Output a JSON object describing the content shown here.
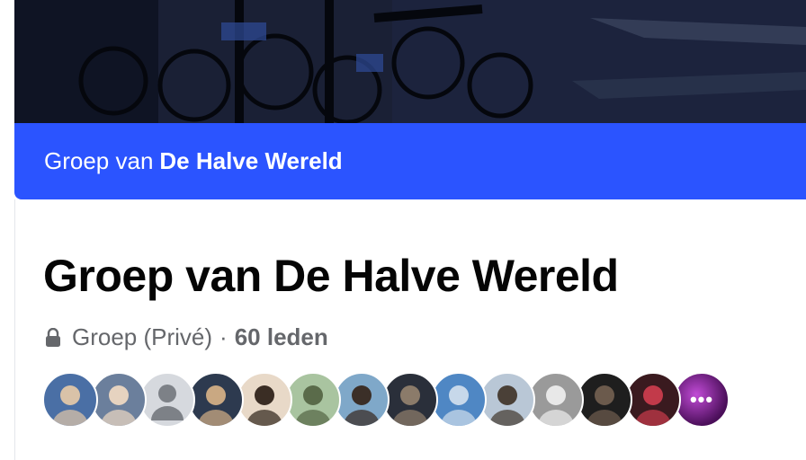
{
  "group": {
    "banner_prefix": "Groep van",
    "banner_name": "De Halve Wereld",
    "title": "Groep van De Halve Wereld",
    "privacy": "Groep (Privé)",
    "separator": "·",
    "members": "60 leden"
  },
  "icons": {
    "privacy": "lock-icon",
    "more": "more-dots-icon"
  },
  "more_label": "•••",
  "colors": {
    "banner": "#2b54ff",
    "title": "#050505",
    "meta": "#65676b"
  },
  "avatars": [
    {
      "bg": "#4a6fa5",
      "fg": "#d9c2a8"
    },
    {
      "bg": "#6b7f9c",
      "fg": "#e6d3c0"
    },
    {
      "bg": "#d6d9de",
      "fg": "#7d8187",
      "placeholder": true
    },
    {
      "bg": "#2d3a4f",
      "fg": "#c9a882"
    },
    {
      "bg": "#e8d9c8",
      "fg": "#3a2d24"
    },
    {
      "bg": "#a9c4a0",
      "fg": "#5a6b4a"
    },
    {
      "bg": "#7fa8c9",
      "fg": "#3b2f28"
    },
    {
      "bg": "#2a2f3a",
      "fg": "#8b7b6a"
    },
    {
      "bg": "#4f87c4",
      "fg": "#c7d8ea"
    },
    {
      "bg": "#b9c7d6",
      "fg": "#4a4037"
    },
    {
      "bg": "#9a9a9a",
      "fg": "#e8e8e8"
    },
    {
      "bg": "#1e1e1e",
      "fg": "#6b5a4c"
    },
    {
      "bg": "#3a1a1f",
      "fg": "#c23a4a"
    },
    {
      "bg": "#4b0f5a",
      "fg": "#c14bd6",
      "more": true
    }
  ]
}
